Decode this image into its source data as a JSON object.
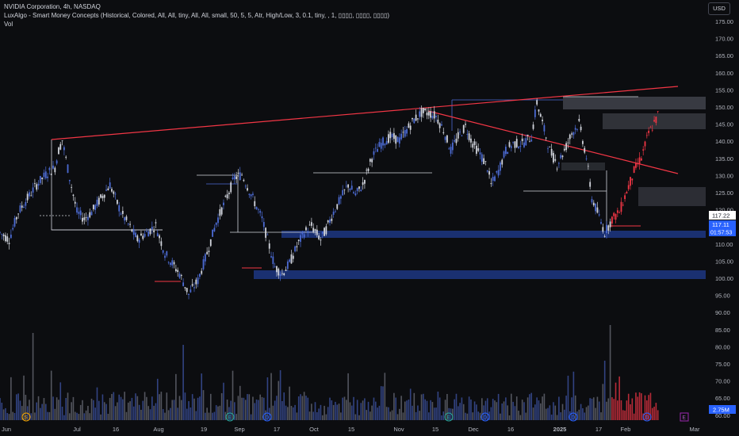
{
  "header": {
    "line1": "NVIDIA Corporation, 4h, NASDAQ",
    "line2": "LuxAlgo - Smart Money Concepts (Historical, Colored, All, All, tiny, All, All, small, 50, 5, 5, Atr, High/Low, 3, 0.1, tiny, , 1, ▯▯▯▯, ▯▯▯▯, ▯▯▯▯)",
    "line3": "Vol"
  },
  "currency_button": "USD",
  "colors": {
    "background": "#0c0d10",
    "candle_up": "#4c6bd4",
    "candle_down": "#d1d4dc",
    "candle_recent": "#f23645",
    "trendline": "#f23645",
    "order_block_blue": "#1e3a8a",
    "zone_gray": "#5d606b"
  },
  "chart_data": {
    "type": "candlestick",
    "title": "NVIDIA Corporation, 4h, NASDAQ",
    "y_axis_ticks": [
      "175.00",
      "170.00",
      "165.00",
      "160.00",
      "155.00",
      "150.00",
      "145.00",
      "140.00",
      "135.00",
      "130.00",
      "125.00",
      "120.00",
      "115.00",
      "110.00",
      "105.00",
      "100.00",
      "95.00",
      "90.00",
      "85.00",
      "80.00",
      "75.00",
      "70.00",
      "65.00",
      "60.00"
    ],
    "x_axis_ticks": [
      "Jun",
      "Jul",
      "16",
      "Aug",
      "19",
      "Sep",
      "17",
      "Oct",
      "15",
      "Nov",
      "15",
      "Dec",
      "16",
      "2025",
      "17",
      "Feb",
      "Mar"
    ],
    "price_labels": [
      {
        "label": "117.22",
        "kind": "last"
      },
      {
        "label": "117.11",
        "kind": "current"
      },
      {
        "label": "01:57:53",
        "kind": "countdown"
      },
      {
        "label": "2.75M",
        "kind": "volume"
      }
    ],
    "series": [
      {
        "kind": "price-close-approx",
        "points": [
          [
            0,
            114
          ],
          [
            5,
            112
          ],
          [
            10,
            120
          ],
          [
            20,
            128
          ],
          [
            25,
            131
          ],
          [
            30,
            133
          ],
          [
            32,
            138
          ],
          [
            34,
            141
          ],
          [
            38,
            130
          ],
          [
            42,
            120
          ],
          [
            46,
            118
          ],
          [
            50,
            120
          ],
          [
            55,
            124
          ],
          [
            60,
            128
          ],
          [
            66,
            120
          ],
          [
            75,
            112
          ],
          [
            85,
            116
          ],
          [
            90,
            108
          ],
          [
            98,
            102
          ],
          [
            103,
            96
          ],
          [
            108,
            100
          ],
          [
            113,
            108
          ],
          [
            118,
            117
          ],
          [
            122,
            122
          ],
          [
            128,
            130
          ],
          [
            132,
            131
          ],
          [
            138,
            124
          ],
          [
            143,
            118
          ],
          [
            146,
            112
          ],
          [
            150,
            104
          ],
          [
            154,
            102
          ],
          [
            158,
            105
          ],
          [
            162,
            110
          ],
          [
            166,
            114
          ],
          [
            170,
            116
          ],
          [
            175,
            112
          ],
          [
            178,
            115
          ],
          [
            182,
            120
          ],
          [
            186,
            124
          ],
          [
            190,
            128
          ],
          [
            194,
            125
          ],
          [
            198,
            128
          ],
          [
            203,
            136
          ],
          [
            208,
            140
          ],
          [
            213,
            142
          ],
          [
            218,
            141
          ],
          [
            222,
            144
          ],
          [
            226,
            147
          ],
          [
            230,
            149
          ],
          [
            234,
            149
          ],
          [
            238,
            148
          ],
          [
            242,
            144
          ],
          [
            246,
            138
          ],
          [
            250,
            142
          ],
          [
            254,
            145
          ],
          [
            258,
            140
          ],
          [
            262,
            137
          ],
          [
            266,
            133
          ],
          [
            268,
            128
          ],
          [
            272,
            132
          ],
          [
            276,
            138
          ],
          [
            280,
            140
          ],
          [
            285,
            140
          ],
          [
            290,
            142
          ],
          [
            293,
            152
          ],
          [
            296,
            146
          ],
          [
            300,
            138
          ],
          [
            304,
            134
          ],
          [
            308,
            138
          ],
          [
            312,
            143
          ],
          [
            316,
            146
          ],
          [
            320,
            136
          ],
          [
            323,
            124
          ],
          [
            326,
            120
          ],
          [
            330,
            114
          ],
          [
            334,
            118
          ],
          [
            338,
            120
          ],
          [
            342,
            126
          ],
          [
            346,
            132
          ],
          [
            350,
            136
          ],
          [
            354,
            143
          ],
          [
            358,
            147
          ],
          [
            360,
            150
          ]
        ]
      },
      {
        "kind": "volume-approx",
        "description": "volume bars 60.00-90.00 scale"
      }
    ]
  }
}
